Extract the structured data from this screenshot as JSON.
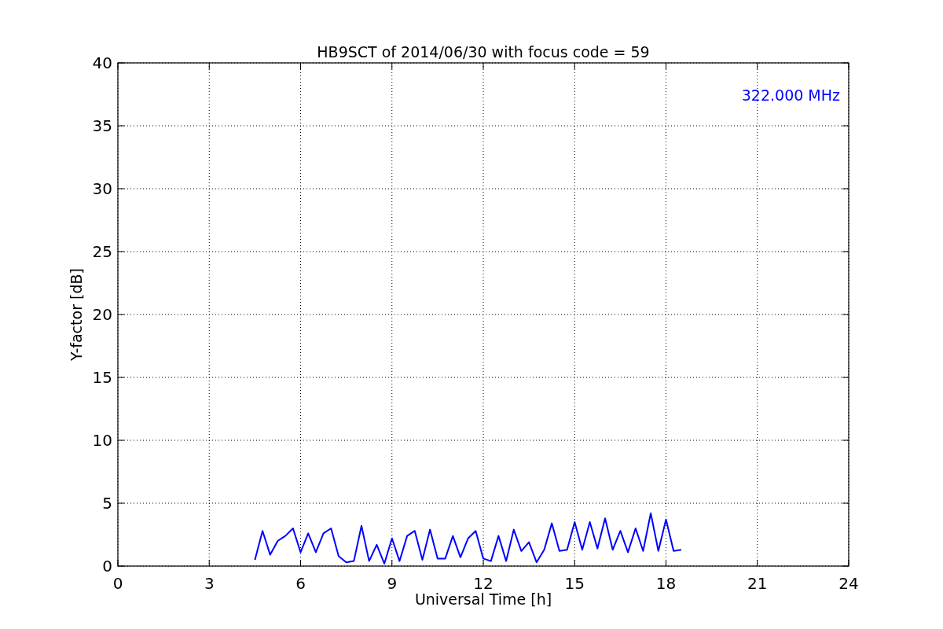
{
  "chart_data": {
    "type": "line",
    "title": "HB9SCT of 2014/06/30 with focus code = 59",
    "xlabel": "Universal Time [h]",
    "ylabel": "Y-factor [dB]",
    "x": [
      4.5,
      4.75,
      5,
      5.25,
      5.5,
      5.75,
      6,
      6.25,
      6.5,
      6.75,
      7,
      7.25,
      7.5,
      7.75,
      8,
      8.25,
      8.5,
      8.75,
      9,
      9.25,
      9.5,
      9.75,
      10,
      10.25,
      10.5,
      10.75,
      11,
      11.25,
      11.5,
      11.75,
      12,
      12.25,
      12.5,
      12.75,
      13,
      13.25,
      13.5,
      13.75,
      14,
      14.25,
      14.5,
      14.75,
      15,
      15.25,
      15.5,
      15.75,
      16,
      16.25,
      16.5,
      16.75,
      17,
      17.25,
      17.5,
      17.75,
      18,
      18.25,
      18.5
    ],
    "series": [
      {
        "name": "322.000 MHz",
        "color": "#0000ff",
        "values": [
          0.5,
          2.8,
          0.9,
          2.0,
          2.4,
          3.0,
          1.1,
          2.6,
          1.1,
          2.6,
          3.0,
          0.8,
          0.3,
          0.4,
          3.2,
          0.4,
          1.7,
          0.2,
          2.2,
          0.4,
          2.4,
          2.8,
          0.5,
          2.9,
          0.6,
          0.6,
          2.4,
          0.7,
          2.2,
          2.8,
          0.6,
          0.4,
          2.4,
          0.4,
          2.9,
          1.2,
          1.9,
          0.3,
          1.3,
          3.4,
          1.2,
          1.3,
          3.5,
          1.3,
          3.5,
          1.4,
          3.8,
          1.3,
          2.8,
          1.1,
          3.0,
          1.2,
          4.2,
          1.2,
          3.7,
          1.2,
          1.3
        ]
      }
    ],
    "xlim": [
      0,
      24
    ],
    "ylim": [
      0,
      40
    ],
    "xticks": [
      0,
      3,
      6,
      9,
      12,
      15,
      18,
      21,
      24
    ],
    "yticks": [
      0,
      5,
      10,
      15,
      20,
      25,
      30,
      35,
      40
    ],
    "grid": true
  }
}
